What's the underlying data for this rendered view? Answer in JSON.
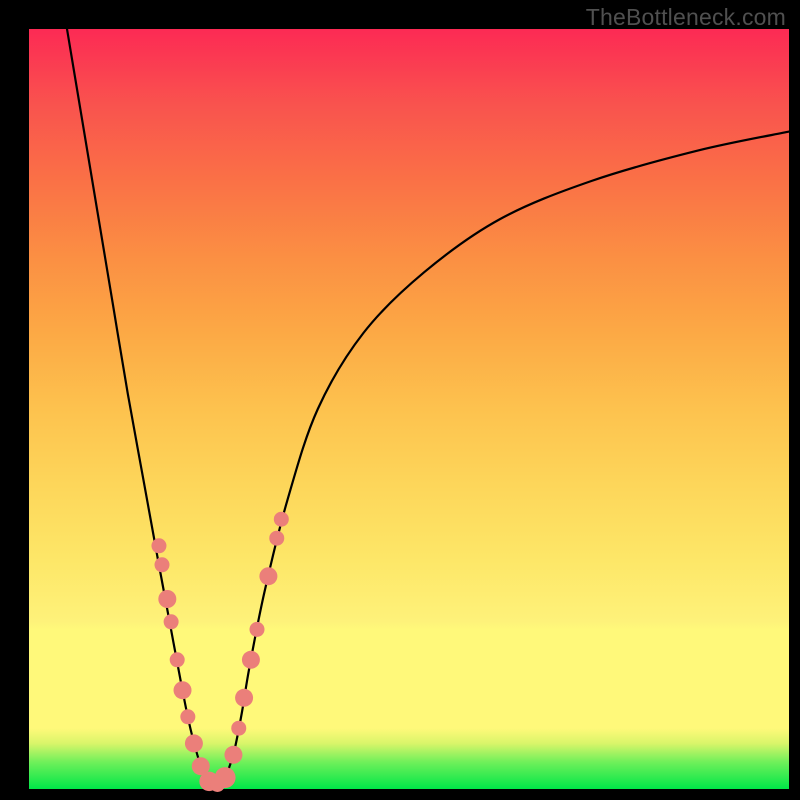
{
  "watermark": "TheBottleneck.com",
  "colors": {
    "frame": "#000000",
    "curve_stroke": "#000000",
    "marker_fill": "#eb7f7a",
    "gradient_top": "#fc2a54",
    "gradient_mid_orange": "#fb8f43",
    "gradient_mid_yellow": "#fde768",
    "gradient_light_band": "#fff97a",
    "gradient_bottom": "#00e648"
  },
  "chart_data": {
    "type": "line",
    "title": "",
    "xlabel": "",
    "ylabel": "",
    "xlim": [
      0,
      100
    ],
    "ylim": [
      0,
      100
    ],
    "legend": null,
    "grid": false,
    "series": [
      {
        "name": "bottleneck-curve",
        "x": [
          5,
          7,
          9,
          11,
          13,
          15,
          17,
          18.5,
          20,
          21,
          22,
          23,
          24,
          25,
          26,
          27,
          28,
          29,
          31,
          34,
          38,
          44,
          52,
          62,
          74,
          88,
          100
        ],
        "y": [
          100,
          88,
          76,
          64,
          52,
          41,
          30,
          22,
          14,
          9,
          5,
          2,
          0.5,
          0.5,
          2,
          5,
          10,
          16,
          26,
          38,
          50,
          60,
          68,
          75,
          80,
          84,
          86.5
        ]
      }
    ],
    "markers": [
      {
        "x": 17.1,
        "y": 32.0,
        "r": 1.0
      },
      {
        "x": 17.5,
        "y": 29.5,
        "r": 1.0
      },
      {
        "x": 18.2,
        "y": 25.0,
        "r": 1.2
      },
      {
        "x": 18.7,
        "y": 22.0,
        "r": 1.0
      },
      {
        "x": 19.5,
        "y": 17.0,
        "r": 1.0
      },
      {
        "x": 20.2,
        "y": 13.0,
        "r": 1.2
      },
      {
        "x": 20.9,
        "y": 9.5,
        "r": 1.0
      },
      {
        "x": 21.7,
        "y": 6.0,
        "r": 1.2
      },
      {
        "x": 22.6,
        "y": 3.0,
        "r": 1.2
      },
      {
        "x": 23.7,
        "y": 1.0,
        "r": 1.3
      },
      {
        "x": 24.8,
        "y": 0.6,
        "r": 1.0
      },
      {
        "x": 25.8,
        "y": 1.5,
        "r": 1.4
      },
      {
        "x": 26.9,
        "y": 4.5,
        "r": 1.2
      },
      {
        "x": 27.6,
        "y": 8.0,
        "r": 1.0
      },
      {
        "x": 28.3,
        "y": 12.0,
        "r": 1.2
      },
      {
        "x": 29.2,
        "y": 17.0,
        "r": 1.2
      },
      {
        "x": 30.0,
        "y": 21.0,
        "r": 1.0
      },
      {
        "x": 31.5,
        "y": 28.0,
        "r": 1.2
      },
      {
        "x": 32.6,
        "y": 33.0,
        "r": 1.0
      },
      {
        "x": 33.2,
        "y": 35.5,
        "r": 1.0
      }
    ]
  }
}
